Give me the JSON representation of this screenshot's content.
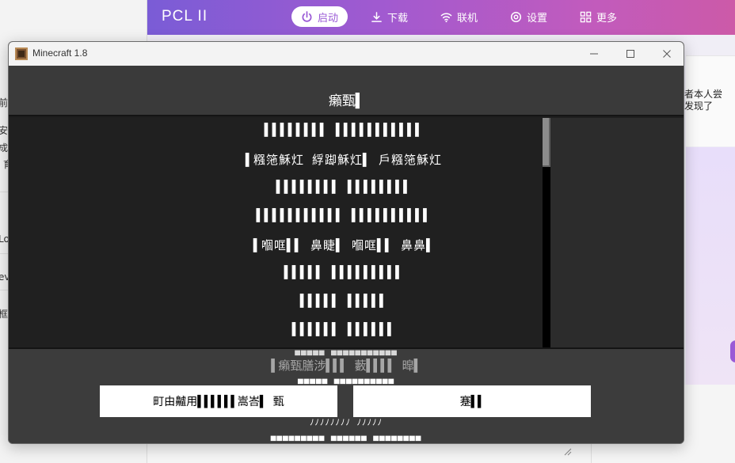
{
  "background": {
    "left_fragments": [
      "前",
      "安裝",
      "成后",
      "育",
      "Lo",
      "ev",
      "框"
    ],
    "pcl": {
      "title": "PCL II",
      "nav": [
        {
          "label": "启动",
          "icon": "power-icon",
          "active": true
        },
        {
          "label": "下载",
          "icon": "download-icon",
          "active": false
        },
        {
          "label": "联机",
          "icon": "wifi-icon",
          "active": false
        },
        {
          "label": "设置",
          "icon": "settings-icon",
          "active": false
        },
        {
          "label": "更多",
          "icon": "grid-icon",
          "active": false
        }
      ],
      "side_text_line1": "者本人尝",
      "side_text_line2": "发现了",
      "accent_color": "#9a5ad6"
    }
  },
  "minecraft": {
    "window_title": "Minecraft 1.8",
    "heading": "癩甄▌",
    "rows": [
      "▌▌▌▌▌▌▌▌ ▌▌▌▌▌▌▌▌▌▌▌",
      "▌糨筂穌灴 綒踋穌灴▌ 戶糨筂穌灴",
      "▌▌▌▌▌▌▌▌ ▌▌▌▌▌▌▌▌",
      "▌▌▌▌▌▌▌▌▌▌▌ ▌▌▌▌▌▌▌▌▌▌",
      "▌嗰哐▌▌ 鼻睫▌ 嗰哐▌▌ 鼻鼻▌",
      "▌▌▌▌▌ ▌▌▌▌▌▌▌▌▌",
      "▌▌▌▌▌ ▌▌▌▌▌",
      "▌▌▌▌▌▌ ▌▌▌▌▌▌"
    ],
    "footer_label": "▌癩甄膳涉▌▌▌ 藪▌▌▌▌ 暭▌",
    "overlay_lines": [
      "▀▀▀▀▀ ▀▀▀▀▀▀▀▀▀▀▀",
      "▀▀▀▀▀ ▀▀▀▀▀▀▀▀▀▀",
      "ﾉﾉﾉﾉﾉﾉﾉﾉ ﾉﾉﾉﾉﾉ",
      "▀▀▀▀▀▀▀▀▀ ▀▀▀▀▀▀ ▀▀▀▀▀▀▀▀"
    ],
    "button_left": "町由齇用▌▌▌▌▌▌嵩峇▌ 甄",
    "button_right": "蹇▌▌"
  }
}
